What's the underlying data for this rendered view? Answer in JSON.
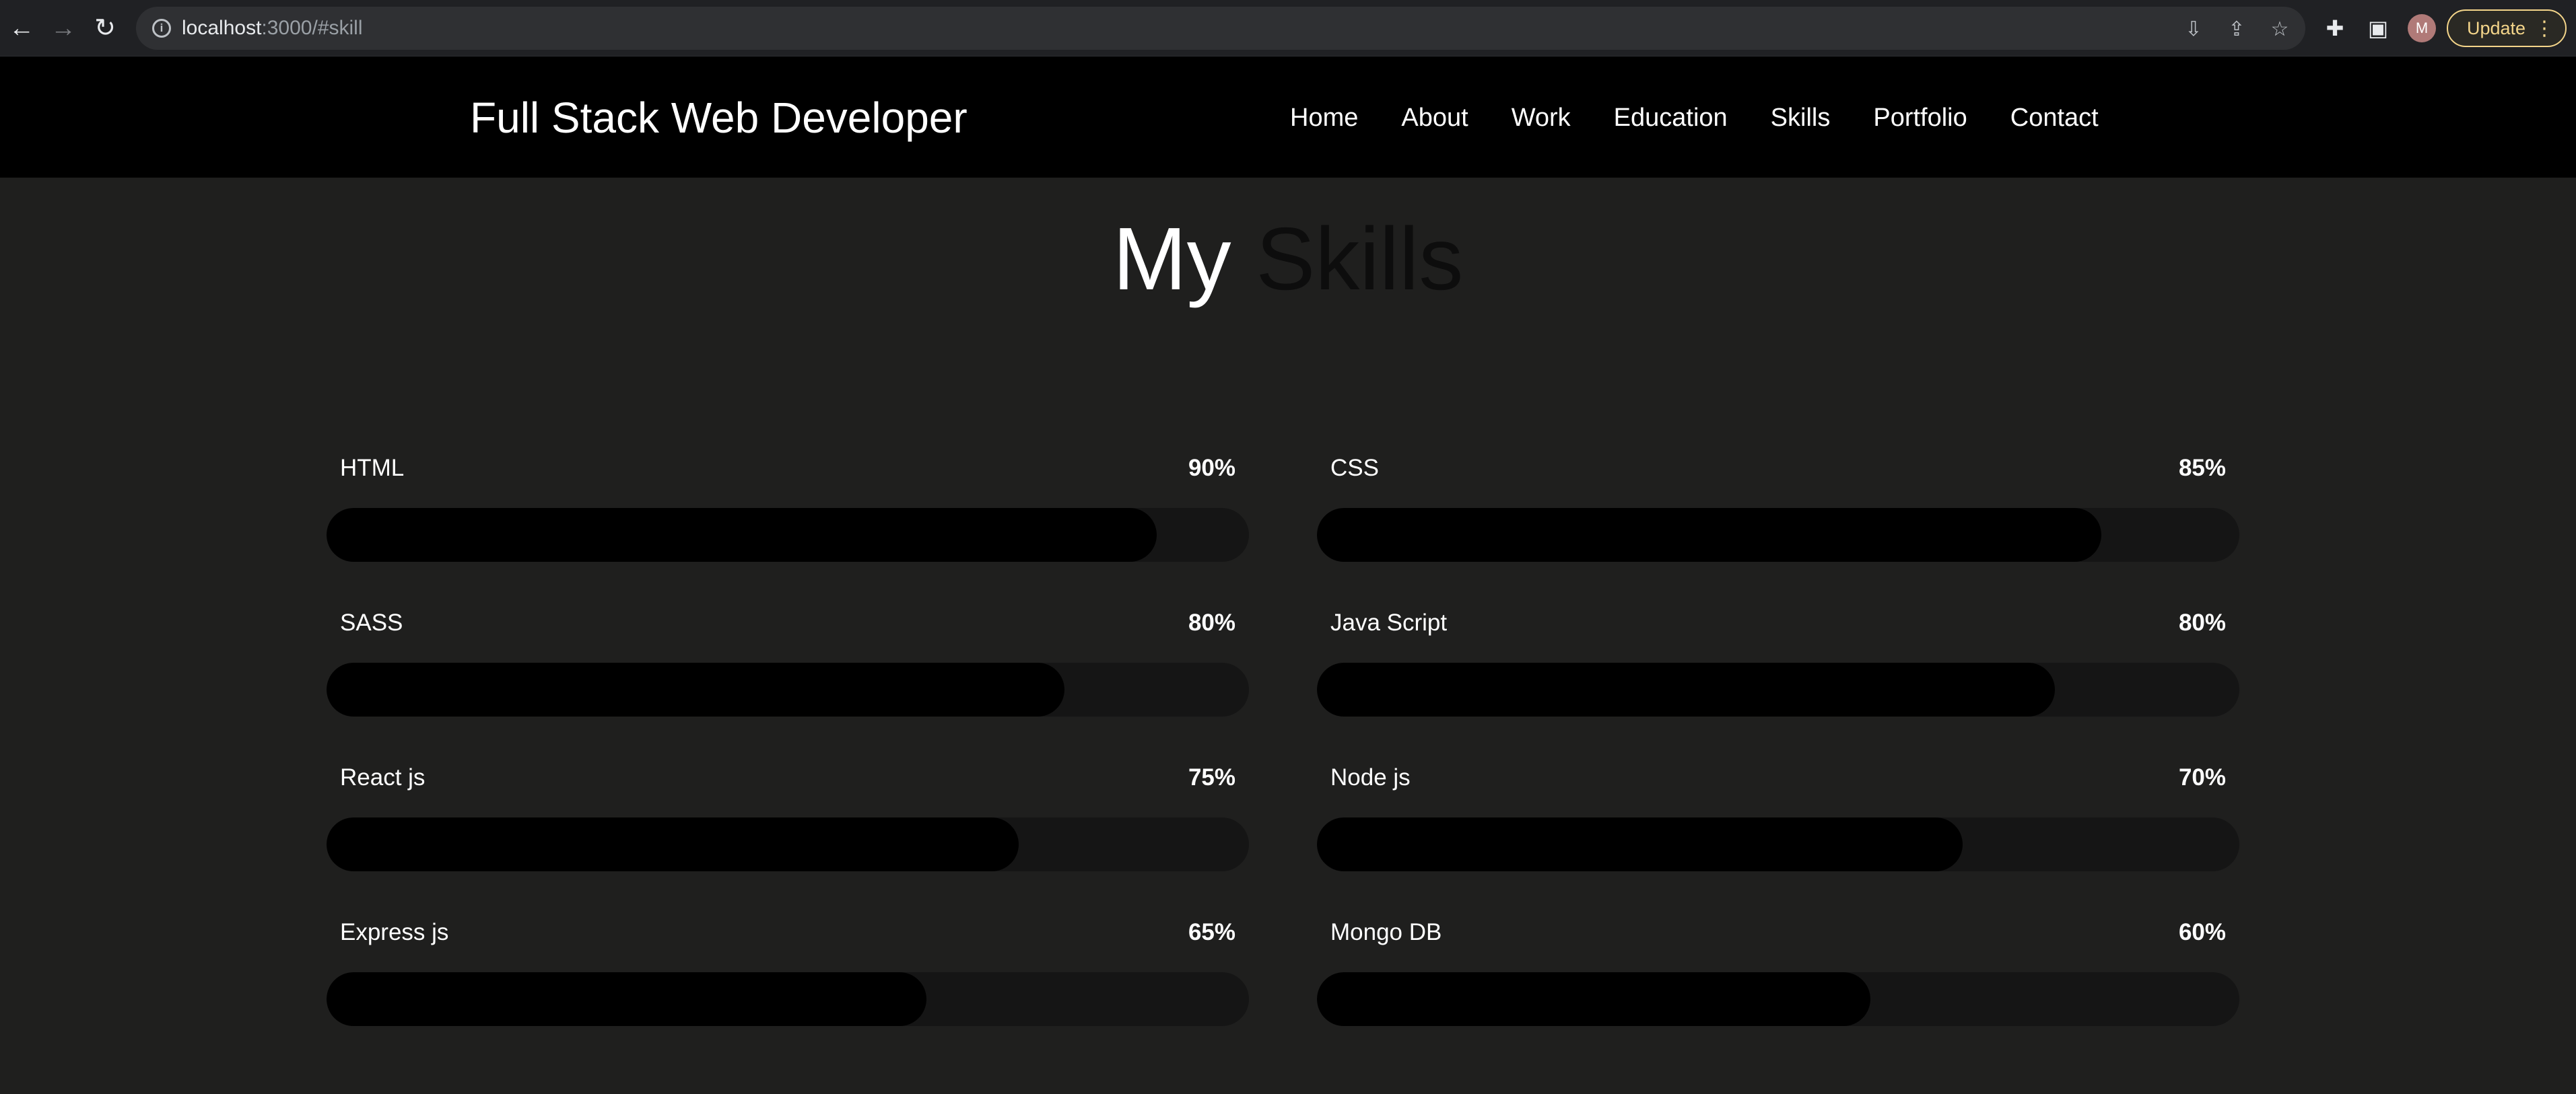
{
  "browser": {
    "url_host": "localhost",
    "url_rest": ":3000/#skill",
    "update_label": "Update",
    "profile_initial": "M",
    "icons": [
      "back-arrow-icon",
      "forward-arrow-icon",
      "reload-icon",
      "info-icon",
      "install-icon",
      "share-icon",
      "star-icon",
      "extensions-icon",
      "side-panel-icon",
      "menu-dots-icon"
    ]
  },
  "header": {
    "brand": "Full Stack Web Developer",
    "nav": [
      "Home",
      "About",
      "Work",
      "Education",
      "Skills",
      "Portfolio",
      "Contact"
    ]
  },
  "main": {
    "title_word1": "My",
    "title_word2": "Skills"
  },
  "skills": [
    {
      "name": "HTML",
      "percent_label": "90%",
      "level": 0.9
    },
    {
      "name": "CSS",
      "percent_label": "85%",
      "level": 0.85
    },
    {
      "name": "SASS",
      "percent_label": "80%",
      "level": 0.8
    },
    {
      "name": "Java Script",
      "percent_label": "80%",
      "level": 0.8
    },
    {
      "name": "React js",
      "percent_label": "75%",
      "level": 0.75
    },
    {
      "name": "Node js",
      "percent_label": "70%",
      "level": 0.7
    },
    {
      "name": "Express js",
      "percent_label": "65%",
      "level": 0.65
    },
    {
      "name": "Mongo DB",
      "percent_label": "60%",
      "level": 0.6
    }
  ],
  "colors": {
    "page_bg": "#1f1f1e",
    "header_bg": "#000000",
    "bar_track": "#151515",
    "bar_fill": "#000000",
    "update_accent": "#f4d58a"
  }
}
